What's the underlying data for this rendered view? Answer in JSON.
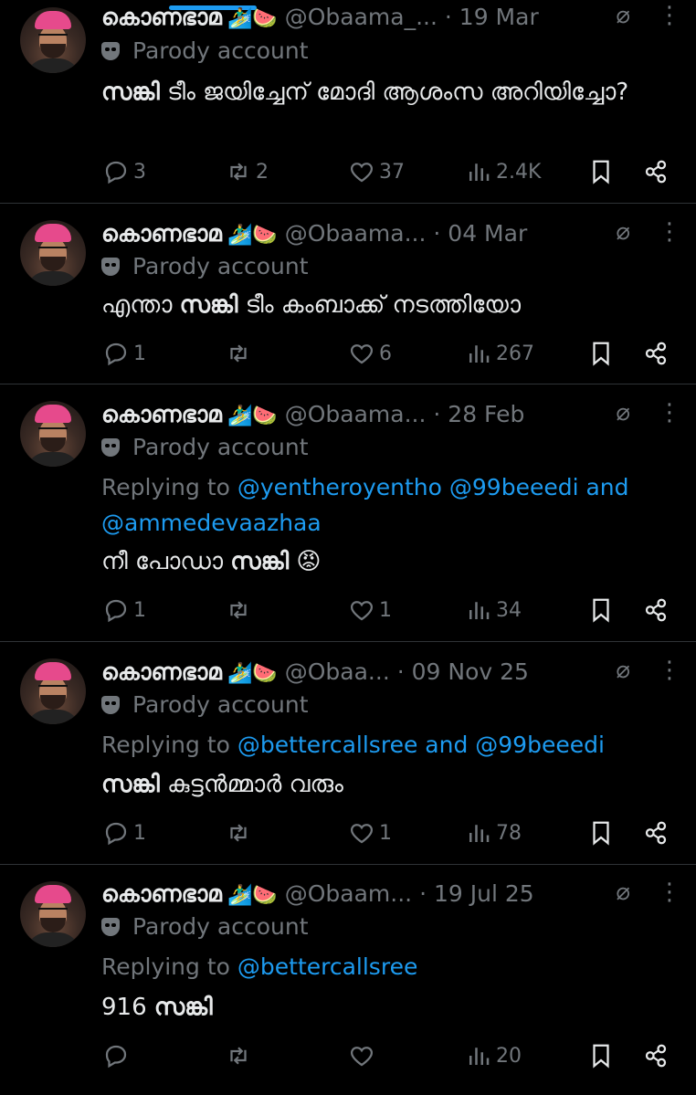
{
  "tweets": [
    {
      "name": "കൊണഭാമ",
      "emoji": "🏄‍♂️🍉",
      "handle": "@Obaama_...",
      "date": "· 19 Mar",
      "parody": "Parody account",
      "reply_prefix": "",
      "mentions": [],
      "body_bold": "സങ്കി",
      "body_rest": " ടീം ജയിച്ചേന് മോദി ആശംസ അറിയിച്ചോ?",
      "body_prefix": "",
      "stats": {
        "replies": "3",
        "reposts": "2",
        "likes": "37",
        "views": "2.4K"
      }
    },
    {
      "name": "കൊണഭാമ",
      "emoji": "🏄‍♂️🍉",
      "handle": "@Obaama...",
      "date": "· 04 Mar",
      "parody": "Parody account",
      "reply_prefix": "",
      "mentions": [],
      "body_prefix": "എന്താ ",
      "body_bold": "സങ്കി",
      "body_rest": " ടീം കംബാക്ക് നടത്തിയോ",
      "stats": {
        "replies": "1",
        "reposts": "",
        "likes": "6",
        "views": "267"
      }
    },
    {
      "name": "കൊണഭാമ",
      "emoji": "🏄‍♂️🍉",
      "handle": "@Obaama...",
      "date": "· 28 Feb",
      "parody": "Parody account",
      "reply_prefix": "Replying to ",
      "mentions": [
        "@yentheroyentho",
        "@99beeedi",
        "and",
        "@ammedevaazhaa"
      ],
      "body_prefix": "നീ പോഡാ ",
      "body_bold": "സങ്കി",
      "body_rest": " 😡",
      "stats": {
        "replies": "1",
        "reposts": "",
        "likes": "1",
        "views": "34"
      }
    },
    {
      "name": "കൊണഭാമ",
      "emoji": "🏄‍♂️🍉",
      "handle": "@Obaa...",
      "date": "· 09 Nov 25",
      "parody": "Parody account",
      "reply_prefix": "Replying to ",
      "mentions": [
        "@bettercallsree",
        "and",
        "@99beeedi"
      ],
      "body_prefix": "",
      "body_bold": "സങ്കി",
      "body_rest": " കുട്ടൻമ്മാർ വരും",
      "stats": {
        "replies": "1",
        "reposts": "",
        "likes": "1",
        "views": "78"
      }
    },
    {
      "name": "കൊണഭാമ",
      "emoji": "🏄‍♂️🍉",
      "handle": "@Obaam...",
      "date": "· 19 Jul 25",
      "parody": "Parody account",
      "reply_prefix": "Replying to ",
      "mentions": [
        "@bettercallsree"
      ],
      "body_prefix": "916 ",
      "body_bold": "സങ്കി",
      "body_rest": "",
      "stats": {
        "replies": "",
        "reposts": "",
        "likes": "",
        "views": "20"
      }
    }
  ],
  "icons": {
    "reply": "reply-icon",
    "repost": "repost-icon",
    "like": "heart-icon",
    "views": "views-icon",
    "bookmark": "bookmark-icon",
    "share": "share-icon",
    "grok": "grok-icon",
    "more": "more-icon",
    "parody": "parody-mask-icon"
  },
  "colors": {
    "accent": "#1d9bf0",
    "muted": "#71767b",
    "text": "#e7e9ea",
    "background": "#000000"
  }
}
